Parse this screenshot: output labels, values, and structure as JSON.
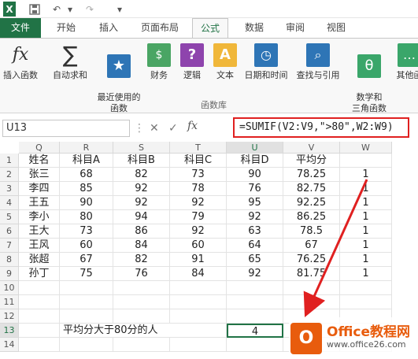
{
  "qat": {
    "app_icon": "X",
    "save": "save-icon",
    "undo": "↶",
    "redo": "↷",
    "customize": "▾"
  },
  "tabs": [
    "文件",
    "开始",
    "插入",
    "页面布局",
    "公式",
    "数据",
    "审阅",
    "视图"
  ],
  "ribbon": {
    "group": "函数库",
    "buttons": [
      "插入函数",
      "自动求和",
      "最近使用的\n函数",
      "财务",
      "逻辑",
      "文本",
      "日期和时间",
      "查找与引用",
      "数学和\n三角函数",
      "其他函"
    ]
  },
  "formula_bar": {
    "name_box": "U13",
    "cancel": "✕",
    "enter": "✓",
    "fx": "fx",
    "formula": "=SUMIF(V2:V9,\">80\",W2:W9)"
  },
  "sheet": {
    "columns": [
      "Q",
      "R",
      "S",
      "T",
      "U",
      "V",
      "W"
    ],
    "rows": [
      "1",
      "2",
      "3",
      "4",
      "5",
      "6",
      "7",
      "8",
      "9",
      "10",
      "11",
      "12",
      "13",
      "14"
    ],
    "data": [
      [
        "姓名",
        "科目A",
        "科目B",
        "科目C",
        "科目D",
        "平均分",
        ""
      ],
      [
        "张三",
        "68",
        "82",
        "73",
        "90",
        "78.25",
        "1"
      ],
      [
        "李四",
        "85",
        "92",
        "78",
        "76",
        "82.75",
        "1"
      ],
      [
        "王五",
        "90",
        "92",
        "92",
        "95",
        "92.25",
        "1"
      ],
      [
        "李小",
        "80",
        "94",
        "79",
        "92",
        "86.25",
        "1"
      ],
      [
        "王大",
        "73",
        "86",
        "92",
        "63",
        "78.5",
        "1"
      ],
      [
        "王风",
        "60",
        "84",
        "60",
        "64",
        "67",
        "1"
      ],
      [
        "张超",
        "67",
        "82",
        "91",
        "65",
        "76.25",
        "1"
      ],
      [
        "孙丁",
        "75",
        "76",
        "84",
        "92",
        "81.75",
        "1"
      ]
    ],
    "label_row13": "平均分大于80分的人",
    "result": "4"
  },
  "watermark": {
    "title": "Office教程网",
    "url": "www.office26.com"
  }
}
